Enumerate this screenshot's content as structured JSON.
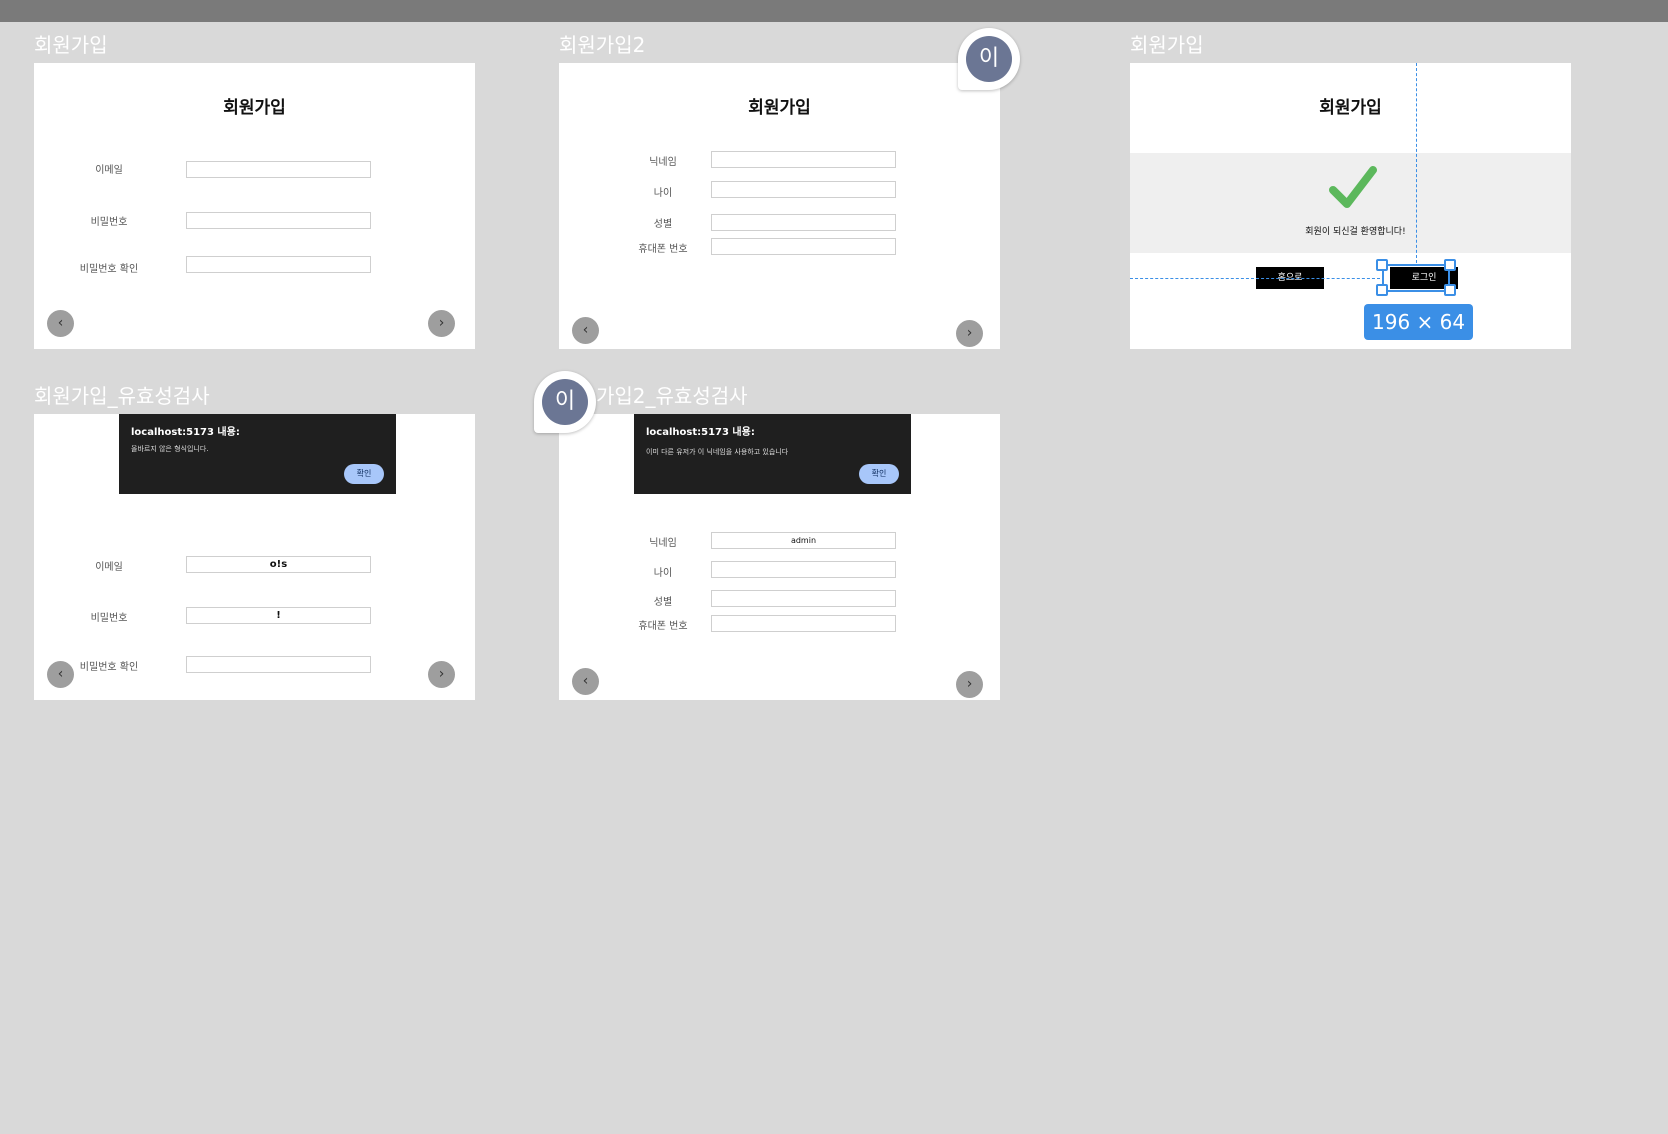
{
  "frames": {
    "f1": {
      "label": "회원가입",
      "title": "회원가입",
      "fields": [
        "이메일",
        "비밀번호",
        "비밀번호 확인"
      ]
    },
    "f2": {
      "label": "회원가입2",
      "title": "회원가입",
      "fields": [
        "닉네임",
        "나이",
        "성별",
        "휴대폰 번호"
      ]
    },
    "f3": {
      "label": "회원가입",
      "title": "회원가입",
      "welcome": "회원이 되신걸 환영합니다!",
      "home_button": "홈으로",
      "login_button": "로그인",
      "selection_size": "196 × 64"
    },
    "f4": {
      "label": "회원가입_유효성검사",
      "fields": [
        "이메일",
        "비밀번호",
        "비밀번호 확인"
      ],
      "values": [
        "o!s",
        "!",
        ""
      ],
      "alert": {
        "title": "localhost:5173 내용:",
        "message": "올바르지 않은 형식입니다.",
        "confirm": "확인"
      }
    },
    "f5": {
      "label": "가입2_유효성검사",
      "fields": [
        "닉네임",
        "나이",
        "성별",
        "휴대폰 번호"
      ],
      "values": [
        "admin",
        "",
        "",
        ""
      ],
      "alert": {
        "title": "localhost:5173 내용:",
        "message": "이미 다른 유저가 이 닉네임을 사용하고 있습니다",
        "confirm": "확인"
      }
    }
  },
  "comments": {
    "avatar_initial": "이"
  },
  "nav": {
    "prev": "‹",
    "next": "›"
  },
  "colors": {
    "canvas": "#d9d9d9",
    "selection": "#3b8fe6",
    "check": "#5cb85c",
    "avatar": "#6b7694"
  }
}
